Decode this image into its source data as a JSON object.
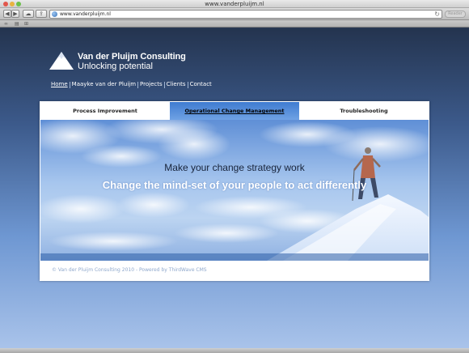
{
  "browser": {
    "window_title": "www.vanderpluijm.nl",
    "url": "www.vanderpluijm.nl",
    "reader_label": "Reader",
    "icons": [
      "back-icon",
      "forward-icon",
      "cloud-icon",
      "share-icon",
      "globe-icon",
      "reload-icon",
      "reading-list-icon",
      "bookmarks-icon",
      "top-sites-icon"
    ]
  },
  "brand": {
    "name": "Van der Pluijm Consulting",
    "tagline": "Unlocking potential"
  },
  "nav": {
    "items": [
      "Home",
      "Maayke van der Pluijm",
      "Projects",
      "Clients",
      "Contact"
    ],
    "active": "Home"
  },
  "tabs": [
    {
      "label": "Process Improvement"
    },
    {
      "label": "Operational Change Management"
    },
    {
      "label": "Troubleshooting"
    }
  ],
  "hero": {
    "headline": "Make your change strategy work",
    "subline": "Change the mind-set of your people to act differently"
  },
  "footer": {
    "copyright": "© Van der Pluijm Consulting 2010 - Powered by",
    "cms_link": "ThirdWave CMS"
  },
  "colors": {
    "active_tab": "#3f7bd0",
    "page_top": "#24344f",
    "page_bottom": "#a9c3ea",
    "footer_text": "#8fa8cc"
  }
}
